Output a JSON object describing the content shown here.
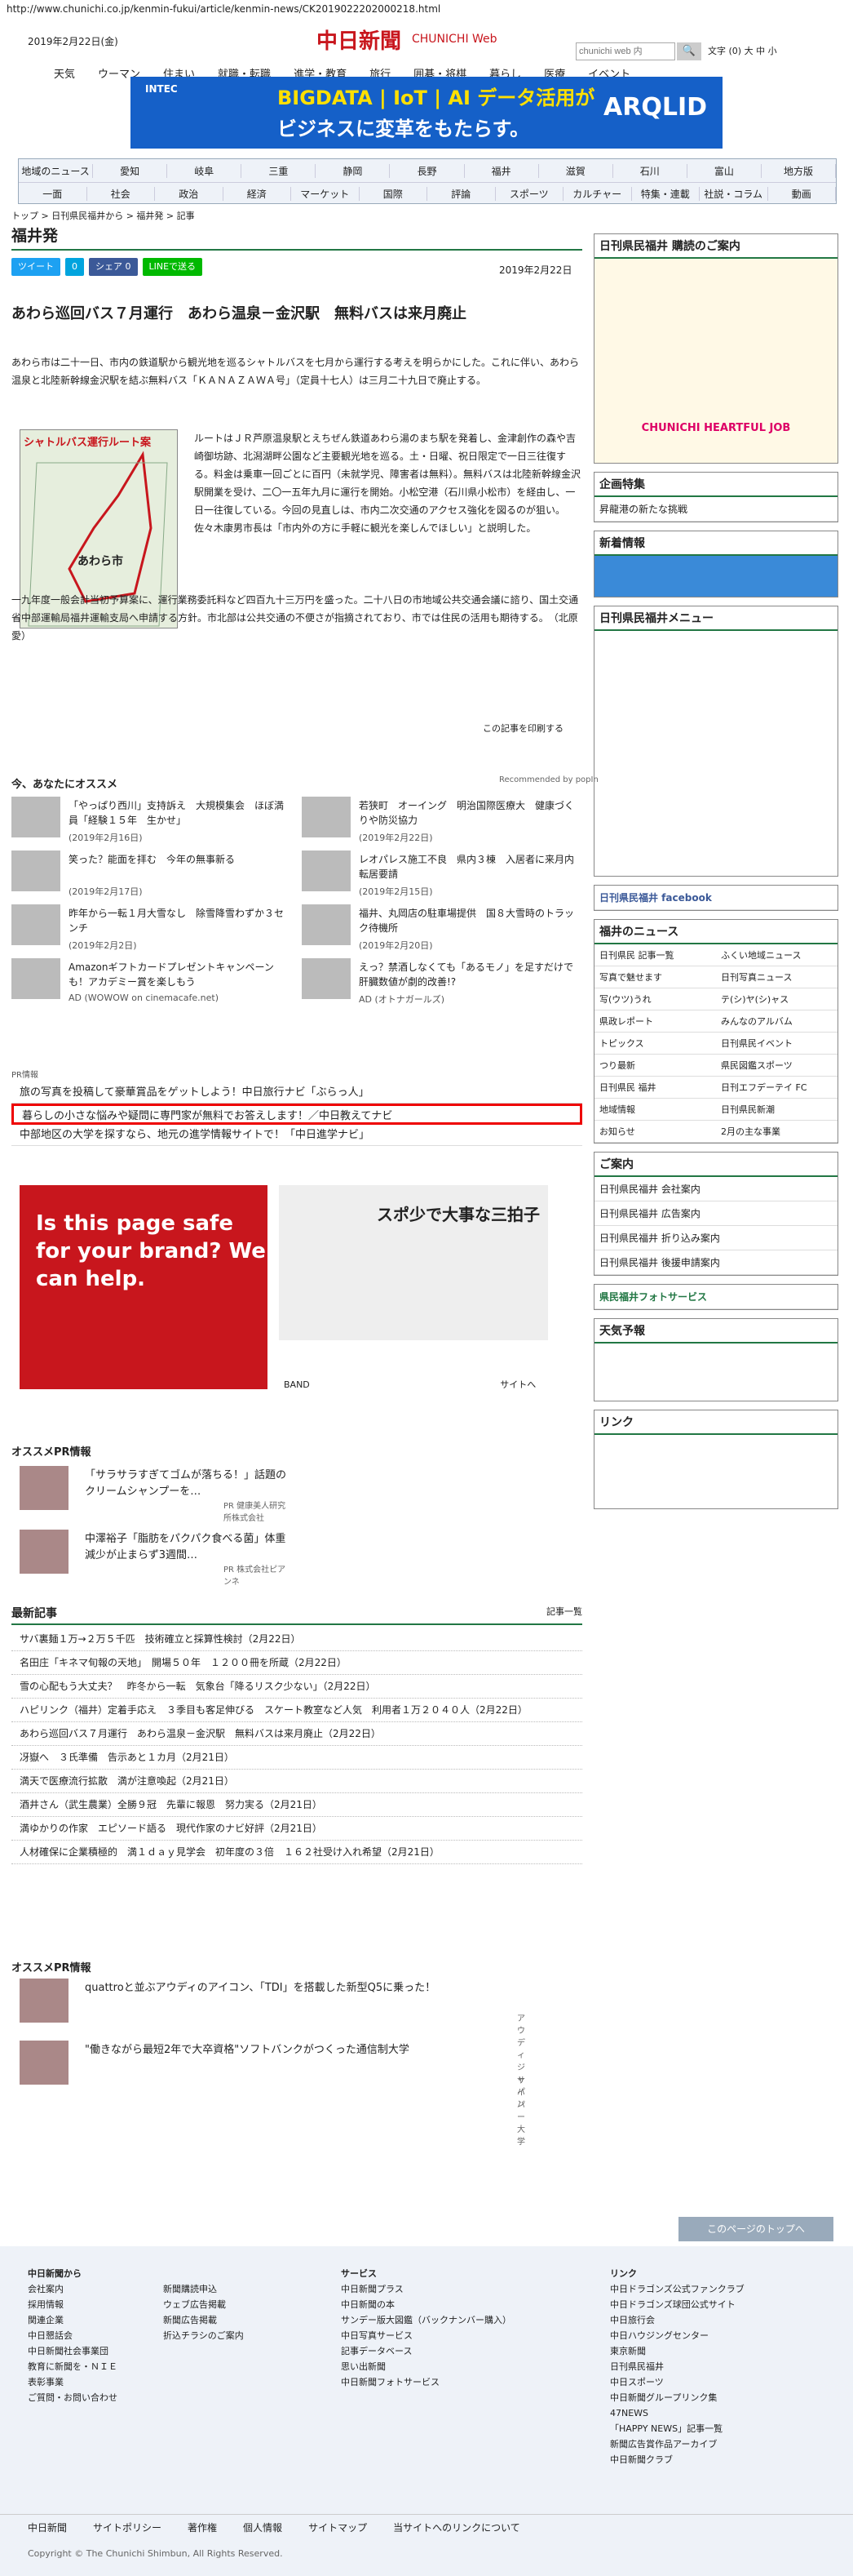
{
  "url": "http://www.chunichi.co.jp/kenmin-fukui/article/kenmin-news/CK2019022202000218.html",
  "header": {
    "date": "2019年2月22日(金)",
    "logo": "中日新聞",
    "logo_en": "CHUNICHI Web",
    "search_placeholder": "chunichi web 内",
    "font_size": "文字 (0) 大 中 小",
    "nav": [
      "天気",
      "ウーマン",
      "住まい",
      "就職・転職",
      "進学・教育",
      "旅行",
      "囲碁・将棋",
      "暮らし",
      "医療",
      "イベント"
    ]
  },
  "banner": {
    "maker": "INTEC",
    "top": "BIGDATA | IoT | AI データ活用が",
    "main": "ビジネスに変革をもたらす。",
    "product": "ARQLID"
  },
  "nav2": {
    "row1": [
      "地域のニュース",
      "愛知",
      "岐阜",
      "三重",
      "静岡",
      "長野",
      "福井",
      "滋賀",
      "石川",
      "富山",
      "地方版"
    ],
    "row2": [
      "一面",
      "社会",
      "政治",
      "経済",
      "マーケット",
      "国際",
      "評論",
      "スポーツ",
      "カルチャー",
      "特集・連載",
      "社説・コラム",
      "動画"
    ]
  },
  "crumb": "トップ > 日刊県民福井から > 福井発 > 記事",
  "page_title": "福井発",
  "share": [
    "ツイート",
    "0",
    "シェア 0",
    "LINEで送る"
  ],
  "pub_date": "2019年2月22日",
  "article": {
    "title": "あわら巡回バス７月運行　あわら温泉－金沢駅　無料バスは来月廃止",
    "lead": "あわら市は二十一日、市内の鉄道駅から観光地を巡るシャトルバスを七月から運行する考えを明らかにした。これに伴い、あわら温泉と北陸新幹線金沢駅を結ぶ無料バス「ＫＡＮＡＺＡＷＡ号」（定員十七人）は三月二十九日で廃止する。",
    "body": "ルートはＪＲ芦原温泉駅とえちぜん鉄道あわら湯のまち駅を発着し、金津創作の森や吉崎御坊跡、北潟湖畔公園など主要観光地を巡る。土・日曜、祝日限定で一日三往復する。料金は乗車一回ごとに百円（未就学児、障害者は無料）。無料バスは北陸新幹線金沢駅開業を受け、二〇一五年九月に運行を開始。小松空港（石川県小松市）を経由し、一日一往復している。今回の見直しは、市内二次交通のアクセス強化を図るのが狙い。佐々木康男市長は「市内外の方に手軽に観光を楽しんでほしい」と説明した。",
    "tail": "一九年度一般会計当初予算案に、運行業務委託料など四百九十三万円を盛った。二十八日の市地域公共交通会議に諮り、国土交通省中部運輸局福井運輸支局へ申請する方針。市北部は公共交通の不便さが指摘されており、市では住民の活用も期待する。　（北原愛）",
    "map_title": "シャトルバス運行ルート案",
    "map_city": "あわら市",
    "print": "この記事を印刷する"
  },
  "recommend": {
    "title": "今、あなたにオススメ",
    "credit": "Recommended by popIn",
    "items": [
      {
        "t": "「やっぱり西川」支持訴え　大規模集会　ほぼ満員「経験１５年　生かせ」",
        "d": "(2019年2月16日)"
      },
      {
        "t": "若狭町　オーイング　明治国際医療大　健康づくりや防災協力",
        "d": "(2019年2月22日)"
      },
      {
        "t": "笑った？能面を拝む　今年の無事新る",
        "d": "(2019年2月17日)"
      },
      {
        "t": "レオパレス施工不良　県内３棟　入居者に来月内転居要請",
        "d": "(2019年2月15日)"
      },
      {
        "t": "昨年から一転１月大雪なし　除雪降雪わずか３センチ",
        "d": "(2019年2月2日)"
      },
      {
        "t": "福井、丸岡店の駐車場提供　国８大雪時のトラック待機所",
        "d": "(2019年2月20日)"
      },
      {
        "t": "Amazonギフトカードプレゼントキャンペーンも！アカデミー賞を楽しもう",
        "d": "AD (WOWOW on cinemacafe.net)"
      },
      {
        "t": "えっ？禁酒しなくても「あるモノ」を足すだけで肝臓数値が劇的改善!?",
        "d": "AD (オトナガールズ)"
      }
    ]
  },
  "pr": {
    "label": "PR情報",
    "items": [
      "旅の写真を投稿して豪華賞品をゲットしよう！中日旅行ナビ「ぶらっ人」",
      "暮らしの小さな悩みや疑問に専門家が無料でお答えします！／中日教えてナビ",
      "中部地区の大学を探すなら、地元の進学情報サイトで！「中日進学ナビ」"
    ]
  },
  "ads": {
    "ad1": "Is this page safe for your brand? We can help.",
    "ad2": "スポ少で大事な三拍子",
    "band": "BAND",
    "band_link": "サイトへ"
  },
  "ospr": {
    "title": "オススメPR情報",
    "items": [
      {
        "t": "「サラサラすぎてゴムが落ちる！」話題のクリームシャンプーを…",
        "d": "PR 健康美人研究所株式会社"
      },
      {
        "t": "中澤裕子「脂肪をパクパク食べる菌」体重減少が止まらず3週間…",
        "d": "PR 株式会社ピアンネ"
      }
    ]
  },
  "latest": {
    "title": "最新記事",
    "more": "記事一覧",
    "items": [
      "サバ裏麺１万→２万５千匹　技術確立と採算性検討（2月22日）",
      "名田庄「キネマ旬報の天地」　開場５０年　１２００冊を所蔵（2月22日）",
      "雪の心配もう大丈夫？　昨冬から一転　気象台「降るリスク少ない」（2月22日）",
      "ハピリンク（福井）定着手応え　３季目も客足伸びる　スケート教室など人気　利用者１万２０４０人（2月22日）",
      "あわら巡回バス７月運行　あわら温泉－金沢駅　無料バスは来月廃止（2月22日）",
      "冴嶽へ　３氏準備　告示あと１カ月（2月21日）",
      "満天で医療流行拡散　満が注意喚起（2月21日）",
      "酒井さん（武生農業）全勝９冠　先輩に報恩　努力実る（2月21日）",
      "満ゆかりの作家　エピソード語る　現代作家のナビ好評（2月21日）",
      "人材確保に企業積極的　満１ｄａｙ見学会　初年度の３倍　１６２社受け入れ希望（2月21日）"
    ]
  },
  "ospr2": {
    "title": "オススメPR情報",
    "items": [
      {
        "t": "quattroと並ぶアウディのアイコン、「TDI」を搭載した新型Q5に乗った！",
        "d": "アウディジャパン"
      },
      {
        "t": "\"働きながら最短2年で大卒資格\"ソフトバンクがつくった通信制大学",
        "d": "サイバー大学"
      }
    ]
  },
  "side": {
    "subscribe": "日刊県民福井 購読のご案内",
    "heartful": "CHUNICHI HEARTFUL JOB",
    "kikaku": "企画特集",
    "kikaku_item": "昇龍港の新たな挑戦",
    "shincho": "新着情報",
    "menu": "日刊県民福井メニュー",
    "fb": "日刊県民福井 facebook",
    "news": "福井のニュース",
    "news_items": [
      "日刊県民 記事一覧",
      "ふくい地域ニュース",
      "写真で魅せます",
      "日刊写真ニュース",
      "写(ウツ)うれ",
      "テ(シ)ヤ(シ)ャス",
      "県政レポート",
      "みんなのアルバム",
      "トピックス",
      "日刊県民イベント",
      "つり最新",
      "県民図鑑スポーツ",
      "日刊県民 福井",
      "日刊エフデーテイ FC",
      "地域情報",
      "日刊県民新潮",
      "お知らせ",
      "2月の主な事業"
    ],
    "annai": "ご案内",
    "annai_items": [
      "日刊県民福井 会社案内",
      "日刊県民福井 広告案内",
      "日刊県民福井 折り込み案内",
      "日刊県民福井 後援申請案内"
    ],
    "photo": "県民福井フォトサービス",
    "weather": "天気予報",
    "link": "リンク"
  },
  "footer": {
    "top": "このページのトップへ",
    "col1": [
      "中日新聞から",
      "会社案内",
      "採用情報",
      "関連企業",
      "中日懇話会",
      "中日新聞社会事業団",
      "教育に新聞を・ＮＩＥ",
      "表彰事業",
      "ご質問・お問い合わせ"
    ],
    "col2": [
      "新聞購読申込",
      "ウェブ広告掲載",
      "新聞広告掲載",
      "折込チラシのご案内"
    ],
    "col3": [
      "サービス",
      "中日新聞プラス",
      "中日新聞の本",
      "サンデー版大図鑑（バックナンバー購入）",
      "中日写真サービス",
      "記事データベース",
      "思い出新聞",
      "中日新聞フォトサービス"
    ],
    "col4": [
      "リンク",
      "中日ドラゴンズ公式ファンクラブ",
      "中日ドラゴンズ球団公式サイト",
      "中日旅行会",
      "中日ハウジングセンター",
      "東京新聞",
      "日刊県民福井",
      "中日スポーツ",
      "中日新聞グループリンク集",
      "47NEWS",
      "「HAPPY NEWS」記事一覧",
      "新聞広告賞作品アーカイブ",
      "中日新聞クラブ"
    ],
    "bottom": [
      "中日新聞",
      "サイトポリシー",
      "著作権",
      "個人情報",
      "サイトマップ",
      "当サイトへのリンクについて"
    ],
    "copy": "Copyright © The Chunichi Shimbun, All Rights Reserved."
  }
}
